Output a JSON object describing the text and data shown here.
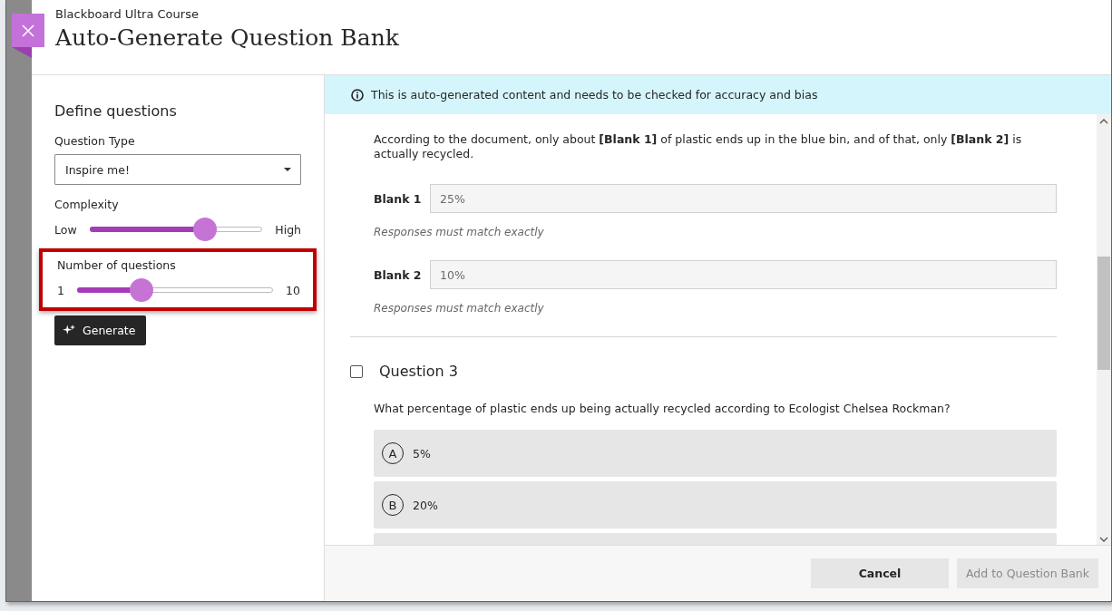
{
  "header": {
    "course": "Blackboard Ultra Course",
    "title": "Auto-Generate Question Bank"
  },
  "settings": {
    "heading": "Define questions",
    "question_type": {
      "label": "Question Type",
      "value": "Inspire me!"
    },
    "sliders": [
      {
        "label": "Complexity",
        "min_label": "Low",
        "max_label": "High",
        "level": 0.67,
        "highlighted": false
      },
      {
        "label": "Number of questions",
        "min_label": "1",
        "max_label": "10",
        "level": 0.33,
        "highlighted": true
      }
    ],
    "generate_button": "Generate"
  },
  "notice": "This is auto-generated content and needs to be checked for accuracy and bias",
  "fill_in": {
    "text": "According to the document, only about **[Blank 1]** of plastic ends up in the blue bin, and of that, only **[Blank 2]** is actually recycled.",
    "blanks": [
      {
        "label": "Blank 1",
        "value": "25%",
        "note": "Responses must match exactly"
      },
      {
        "label": "Blank 2",
        "value": "10%",
        "note": "Responses must match exactly"
      }
    ]
  },
  "questions": [
    {
      "title": "Question 3",
      "checked": false,
      "prompt": "What percentage of plastic ends up being actually recycled according to Ecologist Chelsea Rockman?",
      "options": [
        {
          "letter": "A",
          "text": "5%"
        },
        {
          "letter": "B",
          "text": "20%"
        }
      ]
    }
  ],
  "footer": {
    "buttons": [
      {
        "label": "Cancel",
        "disabled": false
      },
      {
        "label": "Add to Question Bank",
        "disabled": true
      }
    ]
  }
}
